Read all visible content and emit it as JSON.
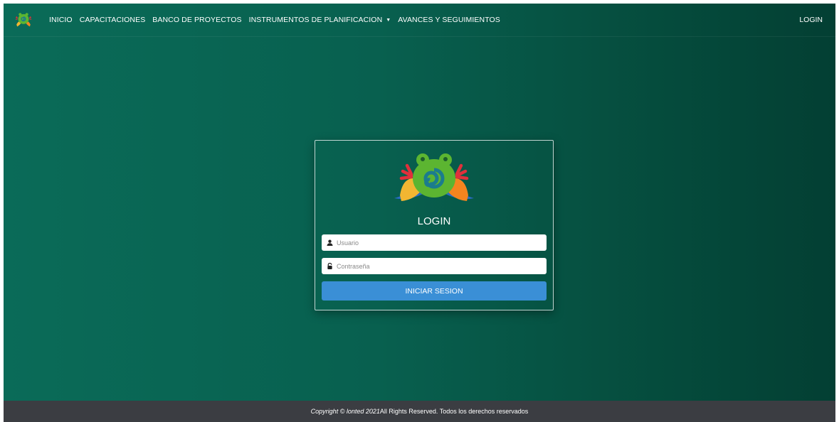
{
  "navbar": {
    "brand_icon": "frog-logo-icon",
    "items": [
      {
        "label": "INICIO"
      },
      {
        "label": "CAPACITACIONES"
      },
      {
        "label": "BANCO DE PROYECTOS"
      },
      {
        "label": "INSTRUMENTOS DE PLANIFICACION",
        "dropdown": true
      },
      {
        "label": "AVANCES Y SEGUIMIENTOS"
      }
    ],
    "login_label": "LOGIN"
  },
  "login_card": {
    "logo_icon": "frog-logo-icon",
    "title": "LOGIN",
    "username": {
      "placeholder": "Usuario",
      "value": "",
      "icon": "user-icon"
    },
    "password": {
      "placeholder": "Contraseña",
      "value": "",
      "icon": "lock-icon"
    },
    "submit_label": "INICIAR SESION"
  },
  "footer": {
    "copyright_prefix": "Copyright © lonted 2021",
    "copyright_suffix": " All Rights Reserved. Todos los derechos reservados"
  },
  "colors": {
    "background_dark_green": "#054b3c",
    "background_green": "#0a6b58",
    "button_blue": "#3a8fd6",
    "footer_gray": "#3b3d42"
  }
}
